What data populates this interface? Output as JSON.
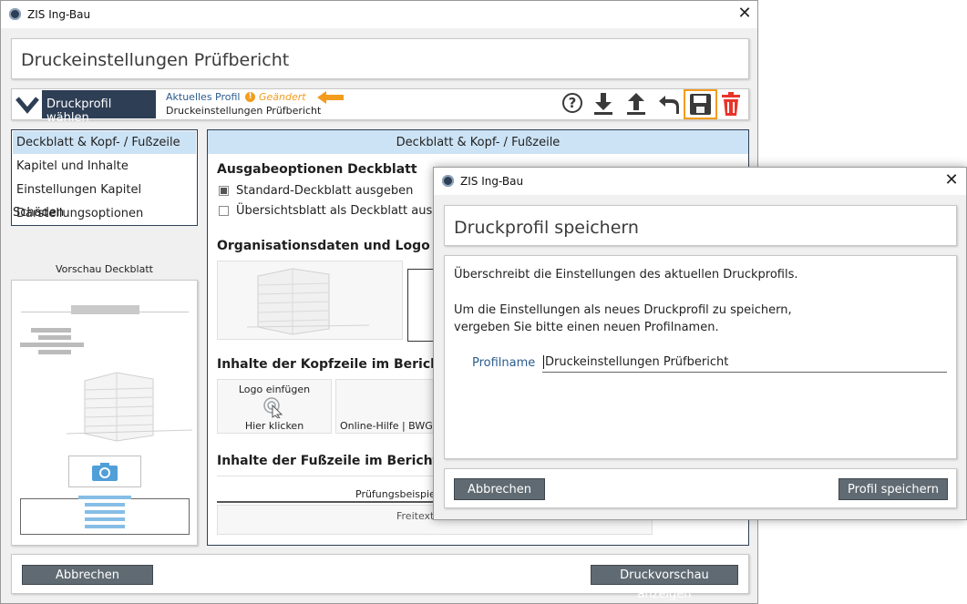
{
  "main_window": {
    "title": "ZIS Ing-Bau",
    "close_glyph": "✕",
    "page_title": "Druckeinstellungen Prüfbericht",
    "profile_button": "Druckprofil wählen",
    "current_profile_label": "Aktuelles Profil",
    "changed_label": "Geändert",
    "current_profile_name": "Druckeinstellungen Prüfbericht",
    "toolbar_icons": [
      "help-icon",
      "download-icon",
      "upload-icon",
      "undo-icon",
      "save-icon",
      "trash-icon"
    ],
    "help_glyph": "?",
    "nav_items": [
      "Deckblatt & Kopf- / Fußzeile",
      "Kapitel und Inhalte",
      "Einstellungen Kapitel Schäden",
      "Darstellungsoptionen"
    ],
    "preview_title": "Vorschau Deckblatt",
    "content_header": "Deckblatt & Kopf- / Fußzeile",
    "section_output": "Ausgabeoptionen Deckblatt",
    "option_standard": "Standard-Deckblatt ausgeben",
    "option_overview": "Übersichtsblatt als Deckblatt ausge",
    "section_org": "Organisationsdaten und Logo De",
    "section_header": "Inhalte der Kopfzeile im Bericht a",
    "logo_insert": "Logo einfügen",
    "click_here": "Hier klicken",
    "header_text": "Online-Hilfe | BWG O",
    "section_footer": "Inhalte der Fußzeile im Bericht an",
    "footer_text": "Prüfungsbeispiel |",
    "footer_freetext": "Freitext",
    "cancel_button": "Abbrechen",
    "preview_button": "Druckvorschau anzeigen"
  },
  "dialog": {
    "title": "ZIS Ing-Bau",
    "close_glyph": "✕",
    "heading": "Druckprofil speichern",
    "line1": "Überschreibt die Einstellungen des aktuellen Druckprofils.",
    "line2": "Um die Einstellungen als neues Druckprofil zu speichern,",
    "line3": "vergeben Sie bitte einen neuen Profilnamen.",
    "field_label": "Profilname",
    "field_value": "Druckeinstellungen Prüfbericht",
    "cancel_button": "Abbrechen",
    "save_button": "Profil speichern"
  },
  "colors": {
    "accent_orange": "#f39c1f",
    "dark_navy": "#2d3e55",
    "selected_blue": "#cce3f5",
    "trash_red": "#e8352b",
    "link_blue": "#2b5c8f"
  },
  "state": {
    "option_standard_checked": true,
    "option_overview_checked": false,
    "selected_nav_index": 0
  }
}
